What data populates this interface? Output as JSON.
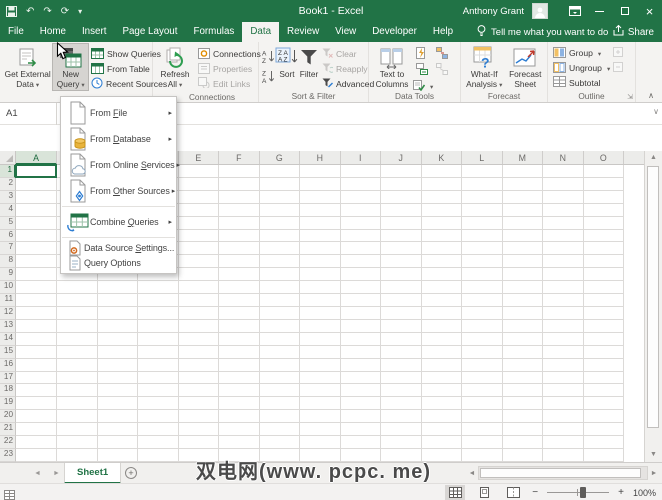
{
  "titlebar": {
    "title": "Book1 - Excel",
    "user": "Anthony Grant"
  },
  "qat_icons": [
    "save",
    "undo",
    "redo",
    "repeat",
    "customize-quick-access"
  ],
  "tabs": {
    "items": [
      "File",
      "Home",
      "Insert",
      "Page Layout",
      "Formulas",
      "Data",
      "Review",
      "View",
      "Developer",
      "Help"
    ],
    "active": "Data",
    "tell_me": "Tell me what you want to do",
    "share": "Share"
  },
  "ribbon": {
    "get_external_data_1": "Get External",
    "get_external_data_2": "Data",
    "new_query_1": "New",
    "new_query_2": "Query",
    "show_queries": "Show Queries",
    "from_table": "From Table",
    "recent_sources": "Recent Sources",
    "refresh_all_1": "Refresh",
    "refresh_all_2": "All",
    "connections": "Connections",
    "properties": "Properties",
    "edit_links": "Edit Links",
    "sort": "Sort",
    "filter": "Filter",
    "clear": "Clear",
    "reapply": "Reapply",
    "advanced": "Advanced",
    "text_to_columns_1": "Text to",
    "text_to_columns_2": "Columns",
    "what_if_1": "What-If",
    "what_if_2": "Analysis",
    "forecast_sheet_1": "Forecast",
    "forecast_sheet_2": "Sheet",
    "group": "Group",
    "ungroup": "Ungroup",
    "subtotal": "Subtotal",
    "labels": {
      "connections": "Connections",
      "sort_filter": "Sort & Filter",
      "data_tools": "Data Tools",
      "forecast": "Forecast",
      "outline": "Outline"
    }
  },
  "menu": {
    "items": [
      {
        "id": "from-file",
        "label": "From File",
        "u": 5,
        "icon": "file",
        "arrow": true,
        "size": "large",
        "sep_before": false
      },
      {
        "id": "from-database",
        "label": "From Database",
        "u": 5,
        "icon": "database",
        "arrow": true,
        "size": "large",
        "sep_before": false
      },
      {
        "id": "from-online-services",
        "label": "From Online Services",
        "u": 12,
        "icon": "cloud",
        "arrow": true,
        "size": "large",
        "sep_before": false
      },
      {
        "id": "from-other-sources",
        "label": "From Other Sources",
        "u": 5,
        "icon": "sources",
        "arrow": true,
        "size": "large",
        "sep_before": false
      },
      {
        "id": "combine-queries",
        "label": "Combine Queries",
        "u": 8,
        "icon": "combine",
        "arrow": true,
        "size": "large",
        "sep_before": true
      },
      {
        "id": "data-source-settings",
        "label": "Data Source Settings...",
        "u": 12,
        "icon": "settings",
        "arrow": false,
        "size": "small",
        "sep_before": true
      },
      {
        "id": "query-options",
        "label": "Query Options",
        "u": null,
        "icon": "options",
        "arrow": false,
        "size": "small",
        "sep_before": false
      }
    ]
  },
  "formula_bar": {
    "name_box": "A1"
  },
  "grid": {
    "columns": [
      "A",
      "B",
      "C",
      "D",
      "E",
      "F",
      "G",
      "H",
      "I",
      "J",
      "K",
      "L",
      "M",
      "N",
      "O"
    ],
    "row_count": 23,
    "selected_cell": "A1"
  },
  "sheet": {
    "tab": "Sheet1"
  },
  "watermark": "双电网(www. pcpc. me)",
  "status": {
    "views": [
      "normal",
      "page-layout",
      "page-break-preview"
    ],
    "zoom_level": "100%"
  },
  "colors": {
    "excel_green": "#217346",
    "ribbon_bg": "#f4f3f1",
    "selection": "#217346"
  }
}
